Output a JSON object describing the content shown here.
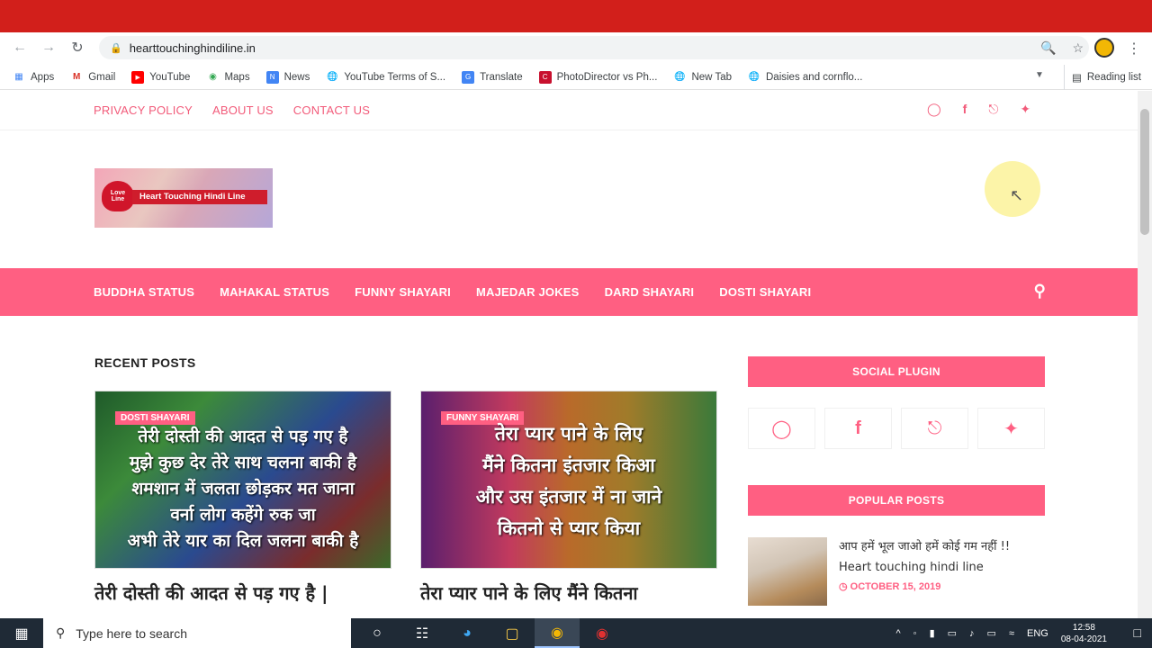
{
  "browser": {
    "url": "hearttouchinghindiline.in",
    "bookmarks": [
      "Apps",
      "Gmail",
      "YouTube",
      "Maps",
      "News",
      "YouTube Terms of S...",
      "Translate",
      "PhotoDirector vs Ph...",
      "New Tab",
      "Daisies and cornflo..."
    ],
    "reading_list": "Reading list"
  },
  "site": {
    "top_links": [
      "PRIVACY POLICY",
      "ABOUT US",
      "CONTACT US"
    ],
    "logo_text": "Heart Touching Hindi Line",
    "logo_badge": "Love Line",
    "nav": [
      "BUDDHA STATUS",
      "MAHAKAL STATUS",
      "FUNNY SHAYARI",
      "MAJEDAR JOKES",
      "DARD SHAYARI",
      "DOSTI SHAYARI"
    ],
    "recent_title": "RECENT POSTS",
    "posts": [
      {
        "category": "DOSTI SHAYARI",
        "lines": [
          "तेरी दोस्ती की आदत से पड़ गए है",
          "मुझे कुछ देर तेरे साथ चलना बाकी है",
          "शमशान में जलता छोड़कर मत जाना",
          "वर्ना लोग कहेंगे रुक जा",
          "अभी तेरे यार का दिल जलना बाकी है"
        ],
        "title": "तेरी दोस्ती की आदत से पड़ गए है |"
      },
      {
        "category": "FUNNY SHAYARI",
        "lines": [
          "तेरा प्यार पाने के लिए",
          "मैंने कितना इंतजार किआ",
          "और उस इंतजार में ना जाने",
          "कितनो से प्यार किया"
        ],
        "title": "तेरा प्यार पाने के लिए मैंने कितना"
      }
    ],
    "sidebar": {
      "social_title": "SOCIAL PLUGIN",
      "popular_title": "POPULAR POSTS",
      "popular_post_title": "आप हमें भूल जाओ हमें कोई गम नहीं !! Heart touching hindi line",
      "popular_post_date": "OCTOBER 15, 2019"
    }
  },
  "taskbar": {
    "search_placeholder": "Type here to search",
    "lang": "ENG",
    "time": "12:58",
    "date": "08-04-2021"
  }
}
